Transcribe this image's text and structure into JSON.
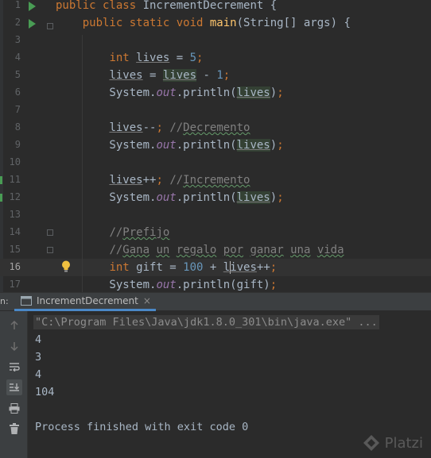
{
  "editor": {
    "lines": [
      {
        "n": "1",
        "html": "<span class=\"kw\">public class </span>IncrementDecrement {"
      },
      {
        "n": "2",
        "html": "    <span class=\"kw\">public static void </span><span class=\"fn\">main</span>(String[] args) {"
      },
      {
        "n": "3",
        "html": ""
      },
      {
        "n": "4",
        "html": "        <span class=\"kw\">int </span><span class=\"var\">lives</span> = <span class=\"num\">5</span><span class=\"kw\">;</span>"
      },
      {
        "n": "5",
        "html": "        <span class=\"var\">lives</span> = <span class=\"var hl\">lives</span> - <span class=\"num\">1</span><span class=\"kw\">;</span>"
      },
      {
        "n": "6",
        "html": "        System.<span class=\"fld\">out</span>.println(<span class=\"var hl\">lives</span>)<span class=\"kw\">;</span>"
      },
      {
        "n": "7",
        "html": ""
      },
      {
        "n": "8",
        "html": "        <span class=\"var\">lives</span>--<span class=\"kw\">; </span><span class=\"cmt\">//<span class=\"typo\">Decremento</span></span>"
      },
      {
        "n": "9",
        "html": "        System.<span class=\"fld\">out</span>.println(<span class=\"var hl\">lives</span>)<span class=\"kw\">;</span>"
      },
      {
        "n": "10",
        "html": ""
      },
      {
        "n": "11",
        "html": "        <span class=\"var\">lives</span>++<span class=\"kw\">; </span><span class=\"cmt\">//<span class=\"typo\">Incremento</span></span>"
      },
      {
        "n": "12",
        "html": "        System.<span class=\"fld\">out</span>.println(<span class=\"var hl\">lives</span>)<span class=\"kw\">;</span>"
      },
      {
        "n": "13",
        "html": ""
      },
      {
        "n": "14",
        "html": "        <span class=\"cmt\">//<span class=\"typo\">Prefijo</span></span>"
      },
      {
        "n": "15",
        "html": "        <span class=\"cmt\">//<span class=\"typo\">Gana</span> <span class=\"typo\">un</span> <span class=\"typo\">regalo</span> <span class=\"typo\">por</span> <span class=\"typo\">ganar</span> <span class=\"typo\">una</span> <span class=\"typo\">vida</span></span>"
      },
      {
        "n": "16",
        "html": "        <span class=\"kw\">int </span>gift = <span class=\"num\">100</span> + <span class=\"var\">l<span class=\"caret\"></span>ives</span>++<span class=\"kw\">;</span>"
      },
      {
        "n": "17",
        "html": "        System.<span class=\"fld\">out</span>.println(gift)<span class=\"kw\">;</span>"
      }
    ]
  },
  "run_panel": {
    "side_label": "n:",
    "tab_title": "IncrementDecrement",
    "tab_close": "×",
    "toolbar_icons": [
      "arrow-up-icon",
      "arrow-down-icon",
      "soft-wrap-icon",
      "scroll-to-end-icon",
      "print-icon",
      "trash-icon"
    ]
  },
  "console": {
    "command": "\"C:\\Program Files\\Java\\jdk1.8.0_301\\bin\\java.exe\" ...",
    "output": [
      "4",
      "3",
      "4",
      "104"
    ],
    "exit_message": "Process finished with exit code 0"
  },
  "watermark": {
    "text": "Platzi"
  },
  "colors": {
    "editor_bg": "#2b2b2b",
    "keyword": "#cc7832",
    "number": "#6897bb",
    "comment": "#808080",
    "field": "#9876aa",
    "method": "#ffc66d",
    "text": "#a9b7c6",
    "panel_bg": "#3c3f41",
    "accent": "#4a88c7",
    "run_green": "#499c54"
  }
}
